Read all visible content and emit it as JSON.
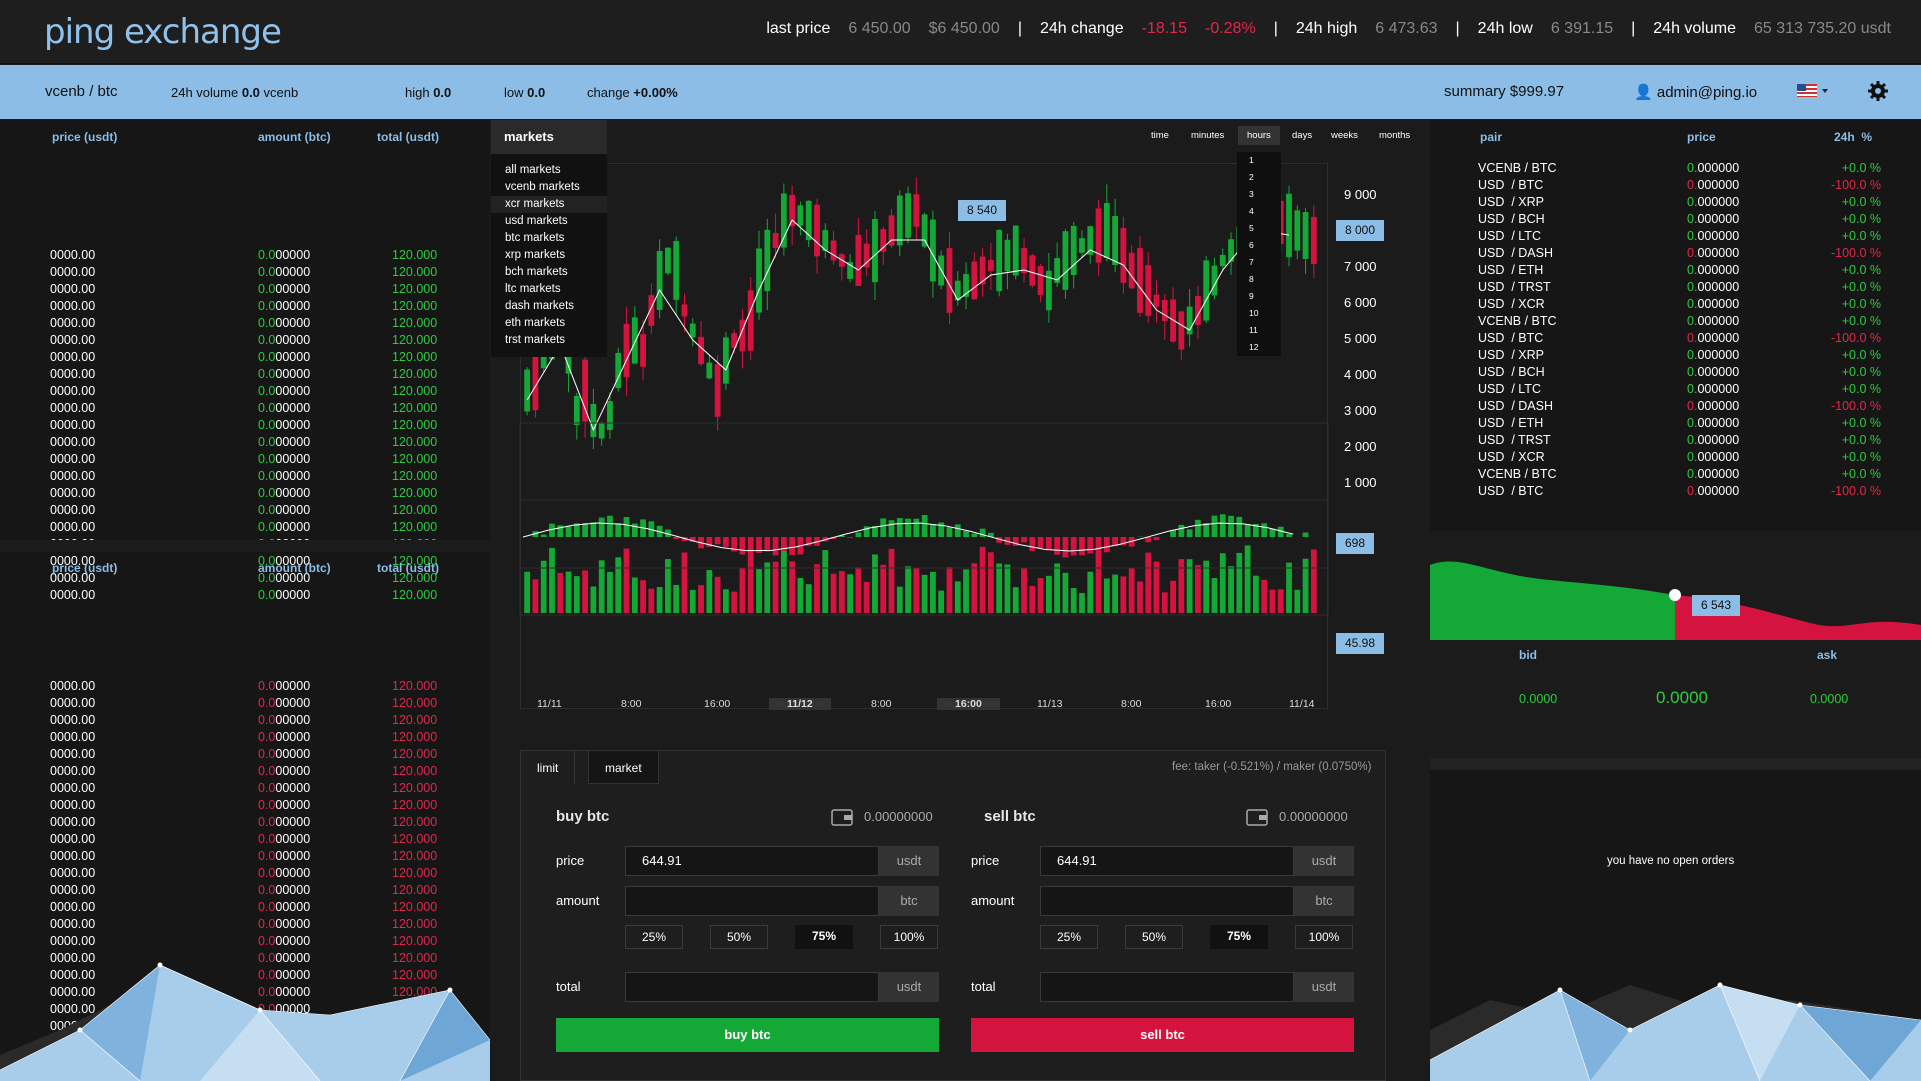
{
  "header": {
    "logo": "ping exchange",
    "stats": [
      {
        "label": "last price",
        "v1": "6 450.00",
        "v2": "$6 450.00"
      },
      {
        "label": "24h change",
        "v1": "-18.15",
        "v2": "-0.28%"
      },
      {
        "label": "24h high",
        "v1": "6 473.63"
      },
      {
        "label": "24h low",
        "v1": "6 391.15"
      },
      {
        "label": "24h volume",
        "v1": "65 313 735.20 usdt"
      }
    ]
  },
  "subbar": {
    "pair": "vcenb / btc",
    "volume_label": "24h volume",
    "volume_value": "0.0",
    "volume_unit": "vcenb",
    "high_label": "high",
    "high_value": "0.0",
    "low_label": "low",
    "low_value": "0.0",
    "change_label": "change",
    "change_value": "+0.00%",
    "summary": "summary $999.97",
    "user": "admin@ping.io"
  },
  "orderbook": {
    "headers": [
      "price (usdt)",
      "amount (btc)",
      "total (usdt)"
    ],
    "price": "0000.00",
    "amount_lead": "0.0",
    "amount_rest": "00000",
    "total": "120.000",
    "rows": 21
  },
  "markets_menu": {
    "title": "markets",
    "items": [
      "all markets",
      "vcenb markets",
      "xcr markets",
      "usd markets",
      "btc markets",
      "xrp markets",
      "bch markets",
      "ltc markets",
      "dash markets",
      "eth markets",
      "trst markets"
    ]
  },
  "timeframes": [
    "time",
    "minutes",
    "hours",
    "days",
    "weeks",
    "months"
  ],
  "hours": [
    "1",
    "2",
    "3",
    "4",
    "5",
    "6",
    "7",
    "8",
    "9",
    "10",
    "11",
    "12"
  ],
  "chart": {
    "yticks": [
      "9 000",
      "8 000",
      "7 000",
      "6 000",
      "5 000",
      "4 000",
      "3 000",
      "2 000",
      "1 000"
    ],
    "tag_high": "8 540",
    "tag_price": "8 000",
    "tag_volume": "698",
    "tag_osc": "45.98",
    "xticks": [
      "11/11",
      "8:00",
      "16:00",
      "11/12",
      "8:00",
      "16:00",
      "11/13",
      "8:00",
      "16:00",
      "11/14"
    ]
  },
  "trade": {
    "tabs": [
      "limit",
      "market"
    ],
    "fee": "fee: taker (-0.521%)  /  maker (0.0750%)",
    "buy_title": "buy btc",
    "sell_title": "sell btc",
    "balance": "0.00000000",
    "price_label": "price",
    "amount_label": "amount",
    "total_label": "total",
    "price_value": "644.91",
    "usdt": "usdt",
    "btc": "btc",
    "pcts": [
      "25%",
      "50%",
      "75%",
      "100%"
    ],
    "buy_btn": "buy btc",
    "sell_btn": "sell btc"
  },
  "pairs": {
    "headers": [
      "pair",
      "price",
      "24h  %"
    ],
    "rows": [
      [
        "VCENB / BTC",
        "+0.0 %"
      ],
      [
        "USD  / BTC",
        "-100.0 %"
      ],
      [
        "USD  / XRP",
        "+0.0 %"
      ],
      [
        "USD  / BCH",
        "+0.0 %"
      ],
      [
        "USD  / LTC",
        "+0.0 %"
      ],
      [
        "USD  / DASH",
        "-100.0 %"
      ],
      [
        "USD  / ETH",
        "+0.0 %"
      ],
      [
        "USD  / TRST",
        "+0.0 %"
      ],
      [
        "USD  / XCR",
        "+0.0 %"
      ],
      [
        "VCENB / BTC",
        "+0.0 %"
      ],
      [
        "USD  / BTC",
        "-100.0 %"
      ],
      [
        "USD  / XRP",
        "+0.0 %"
      ],
      [
        "USD  / BCH",
        "+0.0 %"
      ],
      [
        "USD  / LTC",
        "+0.0 %"
      ],
      [
        "USD  / DASH",
        "-100.0 %"
      ],
      [
        "USD  / ETH",
        "+0.0 %"
      ],
      [
        "USD  / TRST",
        "+0.0 %"
      ],
      [
        "USD  / XCR",
        "+0.0 %"
      ],
      [
        "VCENB / BTC",
        "+0.0 %"
      ],
      [
        "USD  / BTC",
        "-100.0 %"
      ]
    ],
    "price_lead": "0.",
    "price_rest": "000000"
  },
  "depth": {
    "tag": "6 543",
    "bid": "bid",
    "ask": "ask",
    "bid_val": "0.0000",
    "mid_val": "0.0000",
    "ask_val": "0.0000"
  },
  "orders": {
    "empty": "you have no open orders"
  },
  "colors": {
    "accent": "#8bbde6",
    "green": "#14a836",
    "red": "#d4143f"
  }
}
